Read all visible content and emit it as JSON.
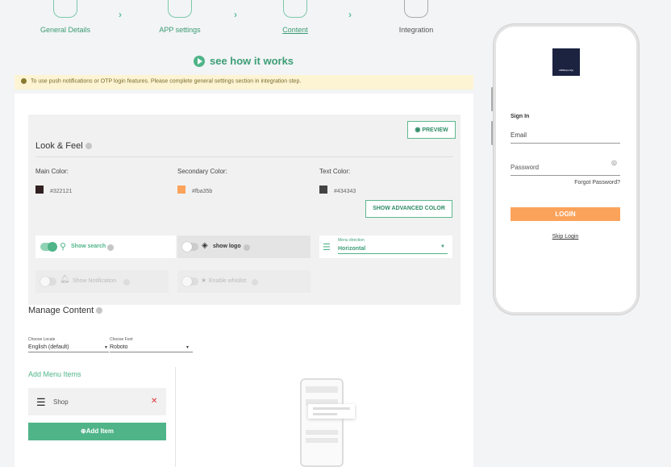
{
  "steps": [
    {
      "label": "General Details"
    },
    {
      "label": "APP settings"
    },
    {
      "label": "Content"
    },
    {
      "label": "Integration"
    }
  ],
  "how_it_works": "see how it works",
  "notice": "To use push notifications or OTP login features. Please complete general settings section in integration step.",
  "look_feel": {
    "title": "Look & Feel",
    "preview": "PREVIEW",
    "main_color_label": "Main Color:",
    "main_color": "#322121",
    "secondary_color_label": "Secondary Color:",
    "secondary_color": "#fba35b",
    "text_color_label": "Text Color:",
    "text_color": "#434343",
    "advanced_btn": "SHOW ADVANCED COLOR"
  },
  "toggles": {
    "show_search": "Show search",
    "show_logo": "show logo",
    "menu_direction_label": "Menu direction",
    "menu_direction_value": "Horizontal",
    "show_notification": "Show Notification",
    "enable_wishlist": "Enable whislist"
  },
  "manage": {
    "title": "Manage Content",
    "locale_label": "Choose Locale",
    "locale_value": "English (default)",
    "font_label": "Choose Font",
    "font_value": "Roboto",
    "add_menu": "Add Menu Items",
    "item": "Shop",
    "add_item": "Add Item"
  },
  "phone": {
    "logo_text": "ABRExpert(s)",
    "sign_in": "Sign In",
    "email": "Email",
    "password": "Password",
    "forgot": "Forgot Password?",
    "login": "LOGIN",
    "skip": "Skip Login"
  },
  "colors": {
    "accent": "#5cb88f",
    "button": "#fba35b",
    "notice": "#fdf4d4"
  }
}
